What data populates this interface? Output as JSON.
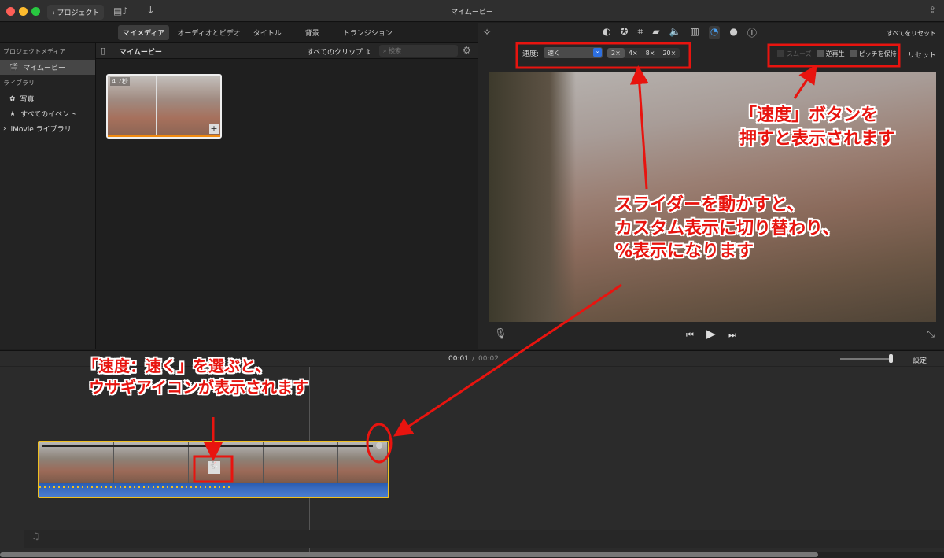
{
  "window": {
    "title": "マイムービー",
    "back_label": "プロジェクト"
  },
  "browser": {
    "tabs": [
      "マイメディア",
      "オーディオとビデオ",
      "タイトル",
      "背景",
      "トランジション"
    ],
    "header_title": "マイムービー",
    "filter": "すべてのクリップ",
    "search_placeholder": "検索"
  },
  "sidebar": {
    "section1": "プロジェクトメディア",
    "project": "マイムービー",
    "section2": "ライブラリ",
    "items": [
      "写真",
      "すべてのイベント"
    ],
    "library": "iMovie ライブラリ"
  },
  "clip": {
    "duration": "4.7秒"
  },
  "viewer": {
    "reset_all": "すべてをリセット",
    "speed_label": "速度:",
    "speed_value": "速く",
    "multipliers": [
      "2×",
      "4×",
      "8×",
      "20×"
    ],
    "checkboxes": [
      "スムーズ",
      "逆再生",
      "ピッチを保持"
    ],
    "reset": "リセット"
  },
  "timeline": {
    "current": "00:01",
    "separator": "/",
    "total": "00:02",
    "settings": "設定"
  },
  "annotations": {
    "a1": [
      "「速度」ボタンを",
      "押すと表示されます"
    ],
    "a2": [
      "スライダーを動かすと、",
      "カスタム表示に切り替わり、",
      "%表示になります"
    ],
    "a3": [
      "「速度：速く」を選ぶと、",
      "ウサギアイコンが表示されます"
    ]
  },
  "colors": {
    "annotation": "#e8140f",
    "accent": "#2d6fe0",
    "selection": "#f0c020"
  }
}
